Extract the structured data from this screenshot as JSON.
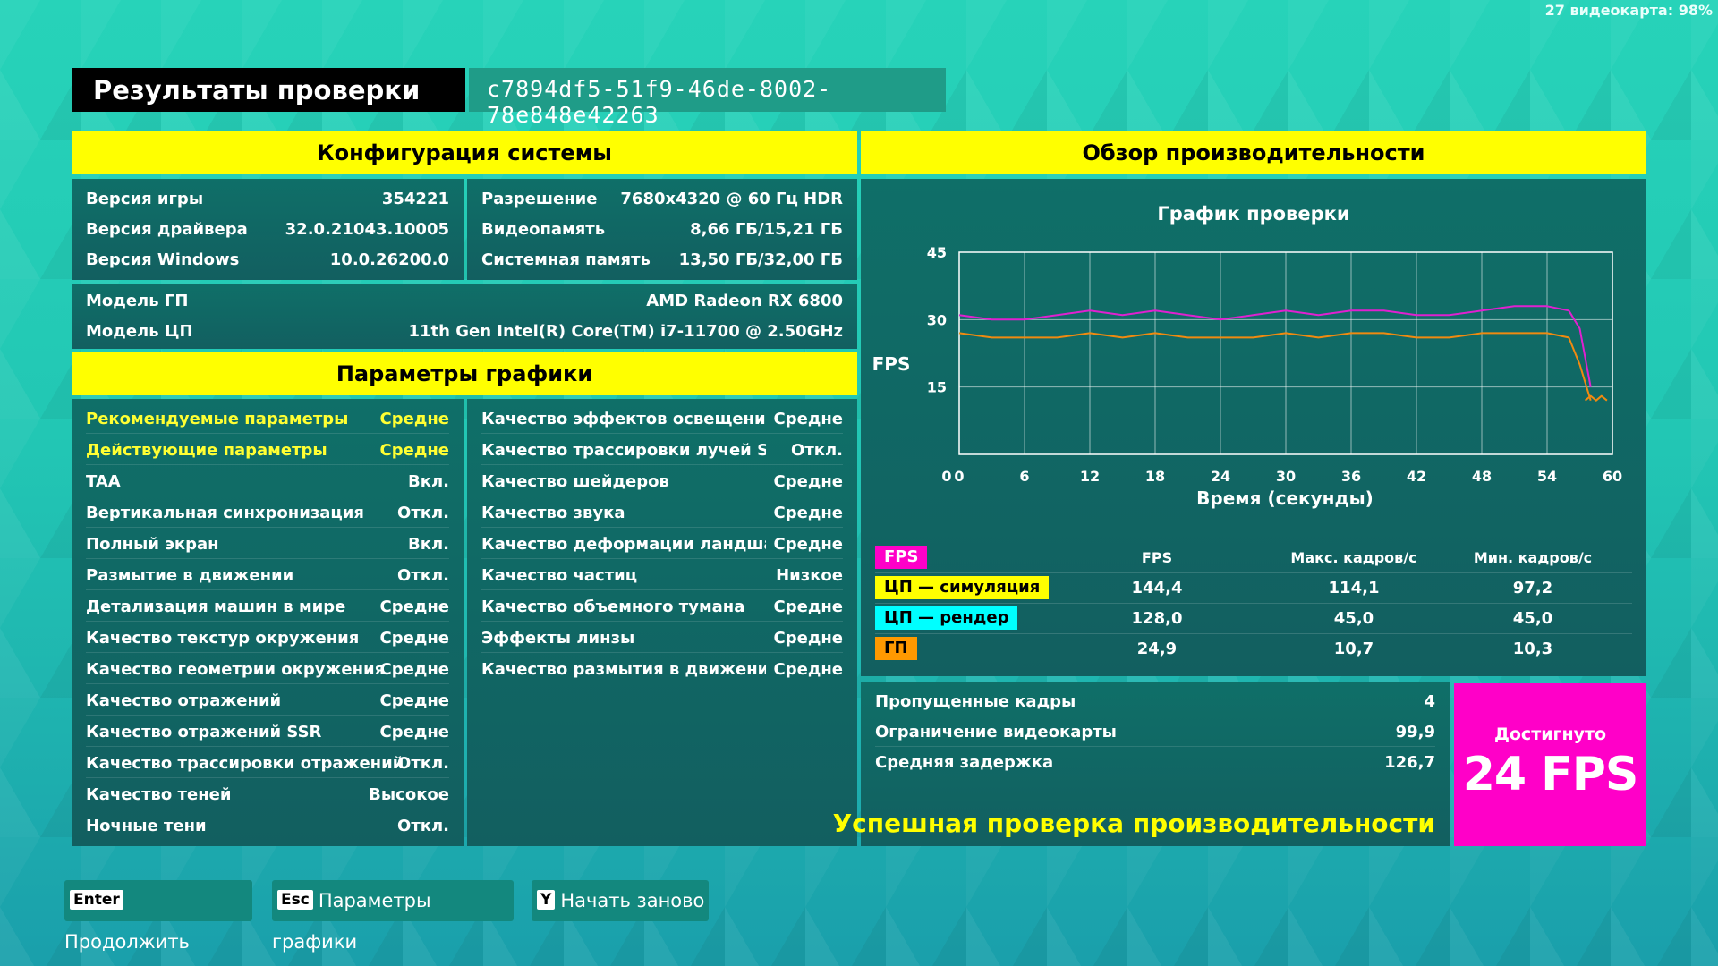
{
  "corner_status": "27 видеокарта: 98%",
  "header": {
    "title": "Результаты проверки",
    "guid": "c7894df5-51f9-46de-8002-78e848e42263"
  },
  "system": {
    "title": "Конфигурация системы",
    "left": [
      {
        "k": "Версия игры",
        "v": "354221"
      },
      {
        "k": "Версия драйвера",
        "v": "32.0.21043.10005"
      },
      {
        "k": "Версия Windows",
        "v": "10.0.26200.0"
      }
    ],
    "right": [
      {
        "k": "Разрешение",
        "v": "7680x4320 @ 60 Гц HDR"
      },
      {
        "k": "Видеопамять",
        "v": "8,66 ГБ/15,21 ГБ"
      },
      {
        "k": "Системная память",
        "v": "13,50 ГБ/32,00 ГБ"
      }
    ],
    "hw": [
      {
        "k": "Модель ГП",
        "v": "AMD Radeon RX 6800"
      },
      {
        "k": "Модель ЦП",
        "v": "11th Gen Intel(R) Core(TM) i7-11700 @ 2.50GHz"
      }
    ]
  },
  "graphics": {
    "title": "Параметры графики",
    "left": [
      {
        "k": "Рекомендуемые параметры",
        "v": "Средне"
      },
      {
        "k": "Действующие параметры",
        "v": "Средне"
      },
      {
        "k": "TAA",
        "v": "Вкл."
      },
      {
        "k": "Вертикальная синхронизация",
        "v": "Откл."
      },
      {
        "k": "Полный экран",
        "v": "Вкл."
      },
      {
        "k": "Размытие в движении",
        "v": "Откл."
      },
      {
        "k": "Детализация машин в мире",
        "v": "Средне"
      },
      {
        "k": "Качество текстур окружения",
        "v": "Средне"
      },
      {
        "k": "Качество геометрии окружения",
        "v": "Средне"
      },
      {
        "k": "Качество отражений",
        "v": "Средне"
      },
      {
        "k": "Качество отражений SSR",
        "v": "Средне"
      },
      {
        "k": "Качество трассировки отражений",
        "v": "Откл."
      },
      {
        "k": "Качество теней",
        "v": "Высокое"
      },
      {
        "k": "Ночные тени",
        "v": "Откл."
      }
    ],
    "right": [
      {
        "k": "Качество эффектов освещения :",
        "v": "Средне"
      },
      {
        "k": "Качество трассировки лучей SSGI",
        "v": "Откл."
      },
      {
        "k": "Качество шейдеров",
        "v": "Средне"
      },
      {
        "k": "Качество звука",
        "v": "Средне"
      },
      {
        "k": "Качество деформации ландшафта",
        "v": "Средне"
      },
      {
        "k": "Качество частиц",
        "v": "Низкое"
      },
      {
        "k": "Качество объемного тумана",
        "v": "Средне"
      },
      {
        "k": "Эффекты линзы",
        "v": "Средне"
      },
      {
        "k": "Качество размытия в движении",
        "v": "Средне"
      }
    ]
  },
  "performance": {
    "title": "Обзор производительности",
    "stats_header": {
      "c1": "FPS",
      "c2": "Макс. кадров/с",
      "c3": "Мин. кадров/с"
    },
    "rows": [
      {
        "label": "FPS",
        "color": "#ff00c8",
        "c1": "",
        "c2": "",
        "c3": ""
      },
      {
        "label": "ЦП — симуляция",
        "color": "#ffff00",
        "c1": "144,4",
        "c2": "114,1",
        "c3": "97,2"
      },
      {
        "label": "ЦП — рендер",
        "color": "#00ffff",
        "c1": "128,0",
        "c2": "45,0",
        "c3": "45,0"
      },
      {
        "label": "ГП",
        "color": "#ff9900",
        "c1": "24,9",
        "c2": "10,7",
        "c3": "10,3"
      }
    ],
    "summary": [
      {
        "k": "Пропущенные кадры",
        "v": "4"
      },
      {
        "k": "Ограничение видеокарты",
        "v": "99,9"
      },
      {
        "k": "Средняя задержка",
        "v": "126,7"
      }
    ],
    "success": "Успешная проверка производительности",
    "achieved_label": "Достигнуто",
    "achieved_value": "24 FPS"
  },
  "chart_data": {
    "type": "line",
    "title": "График проверки",
    "xlabel": "Время (секунды)",
    "ylabel": "FPS",
    "xlim": [
      0,
      60
    ],
    "ylim": [
      0,
      45
    ],
    "xticks": [
      0,
      6,
      12,
      18,
      24,
      30,
      36,
      42,
      48,
      54,
      60
    ],
    "yticks": [
      15,
      30,
      45
    ],
    "grid": true,
    "series": [
      {
        "color": "#e020d0",
        "x": [
          0,
          3,
          6,
          9,
          12,
          15,
          18,
          21,
          24,
          27,
          30,
          33,
          36,
          39,
          42,
          45,
          48,
          51,
          54,
          56,
          57,
          58
        ],
        "values": [
          31,
          30,
          30,
          31,
          32,
          31,
          32,
          31,
          30,
          31,
          32,
          31,
          32,
          32,
          31,
          31,
          32,
          33,
          33,
          32,
          28,
          15
        ]
      },
      {
        "color": "#f08a10",
        "x": [
          0,
          3,
          6,
          9,
          12,
          15,
          18,
          21,
          24,
          27,
          30,
          33,
          36,
          39,
          42,
          45,
          48,
          51,
          54,
          56,
          57,
          58
        ],
        "values": [
          27,
          26,
          26,
          26,
          27,
          26,
          27,
          26,
          26,
          26,
          27,
          26,
          27,
          27,
          26,
          26,
          27,
          27,
          27,
          26,
          20,
          12
        ]
      },
      {
        "color": "#f08a10",
        "x": [
          57.5,
          58,
          58.5,
          59,
          59.5
        ],
        "values": [
          12,
          13,
          12,
          13,
          12
        ]
      }
    ]
  },
  "buttons": [
    {
      "key": "Enter",
      "label": "Продолжить"
    },
    {
      "key": "Esc",
      "label": "Параметры графики"
    },
    {
      "key": "Y",
      "label": "Начать заново"
    }
  ]
}
